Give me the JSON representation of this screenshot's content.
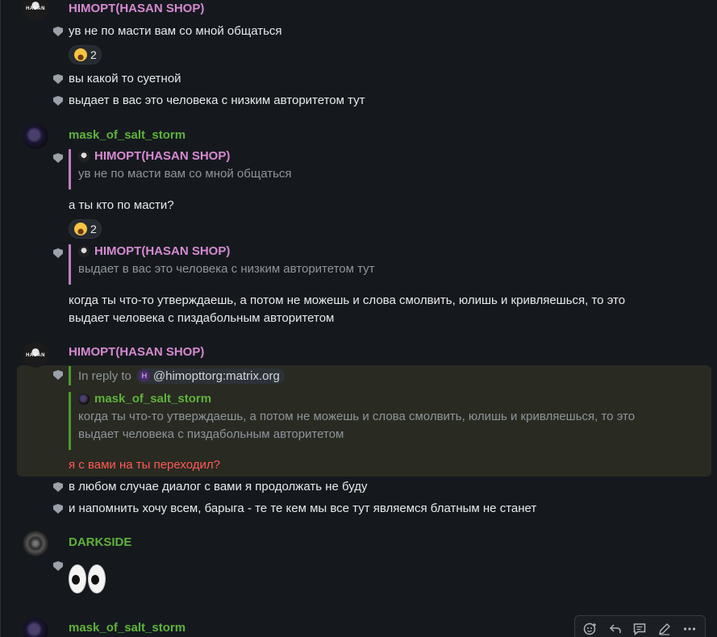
{
  "messages": {
    "group1": {
      "sender": "HIMOPT(HASAN SHOP)",
      "avatar_text": "HASAN",
      "lines": [
        "ув не по масти вам со мной общаться",
        "вы какой то суетной",
        "выдает в вас это человека с низким авторитетом тут"
      ],
      "reaction_count": "2"
    },
    "group2": {
      "sender": "mask_of_salt_storm",
      "reply1": {
        "sender": "HIMOPT(HASAN SHOP)",
        "body": "ув не по масти вам со мной общаться"
      },
      "line1": "а ты кто по масти?",
      "reaction_count": "2",
      "reply2": {
        "sender": "HIMOPT(HASAN SHOP)",
        "body": "выдает в вас это человека с низким авторитетом тут"
      },
      "line2a": "когда ты что-то утверждаешь, а потом не можешь и слова смолвить, юлишь и кривляешься, то это",
      "line2b": "выдает человека с пиздабольным авторитетом"
    },
    "group3": {
      "sender": "HIMOPT(HASAN SHOP)",
      "avatar_text": "HASAN",
      "in_reply_to_label": "In reply to",
      "in_reply_to_user": "@himopttorg:matrix.org",
      "pill_initial": "H",
      "reply": {
        "sender": "mask_of_salt_storm",
        "body_a": "когда ты что-то утверждаешь, а потом не можешь и слова смолвить, юлишь и кривляешься, то это",
        "body_b": "выдает человека с пиздабольным авторитетом"
      },
      "highlight_line": "я с вами на ты переходил?",
      "lines": [
        "в любом случае диалог с вами я продолжать не буду",
        "и напомнить хочу всем, барыга - те те кем мы все тут являемся блатным не станет"
      ]
    },
    "group4": {
      "sender": "DARKSIDE",
      "content": "eyes-emoji"
    },
    "group5": {
      "sender": "mask_of_salt_storm"
    }
  },
  "toolbar": {
    "icons": [
      "react-icon",
      "reply-icon",
      "thread-icon",
      "edit-icon",
      "more-options-icon"
    ]
  },
  "colors": {
    "background": "#15191e",
    "pink_sender": "#d58ad0",
    "green_sender": "#5fb23b",
    "highlight_text": "#ff5b55",
    "highlight_bg": "#292a22"
  }
}
